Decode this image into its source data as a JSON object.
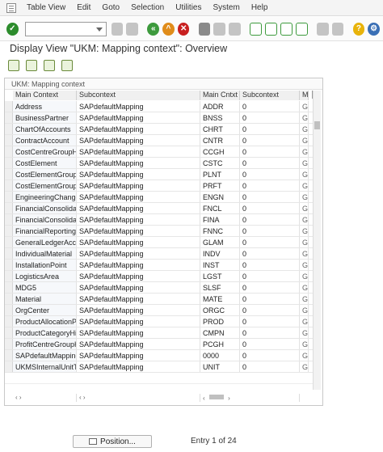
{
  "menubar": {
    "items": [
      "Table View",
      "Edit",
      "Goto",
      "Selection",
      "Utilities",
      "System",
      "Help"
    ]
  },
  "page_title": "Display View \"UKM: Mapping context\": Overview",
  "table": {
    "caption": "UKM: Mapping context",
    "headers": [
      "Main Context",
      "Subcontext",
      "Main Cntxt",
      "Subcontext",
      "Ma"
    ],
    "rows": [
      [
        "Address",
        "SAPdefaultMapping",
        "ADDR",
        "0",
        "G"
      ],
      [
        "BusinessPartner",
        "SAPdefaultMapping",
        "BNSS",
        "0",
        "G"
      ],
      [
        "ChartOfAccounts",
        "SAPdefaultMapping",
        "CHRT",
        "0",
        "G"
      ],
      [
        "ContractAccount",
        "SAPdefaultMapping",
        "CNTR",
        "0",
        "G"
      ],
      [
        "CostCentreGroupHi...",
        "SAPdefaultMapping",
        "CCGH",
        "0",
        "G"
      ],
      [
        "CostElement",
        "SAPdefaultMapping",
        "CSTC",
        "0",
        "G"
      ],
      [
        "CostElementGroup",
        "SAPdefaultMapping",
        "PLNT",
        "0",
        "G"
      ],
      [
        "CostElementGroupH...",
        "SAPdefaultMapping",
        "PRFT",
        "0",
        "G"
      ],
      [
        "EngineeringChange...",
        "SAPdefaultMapping",
        "ENGN",
        "0",
        "G"
      ],
      [
        "FinancialConsolidatio...",
        "SAPdefaultMapping",
        "FNCL",
        "0",
        "G"
      ],
      [
        "FinancialConsolidatio...",
        "SAPdefaultMapping",
        "FINA",
        "0",
        "G"
      ],
      [
        "FinancialReportingSt...",
        "SAPdefaultMapping",
        "FNNC",
        "0",
        "G"
      ],
      [
        "GeneralLedgerAcco...",
        "SAPdefaultMapping",
        "GLAM",
        "0",
        "G"
      ],
      [
        "IndividualMaterial",
        "SAPdefaultMapping",
        "INDV",
        "0",
        "G"
      ],
      [
        "InstallationPoint",
        "SAPdefaultMapping",
        "INST",
        "0",
        "G"
      ],
      [
        "LogisticsArea",
        "SAPdefaultMapping",
        "LGST",
        "0",
        "G"
      ],
      [
        "MDG5",
        "SAPdefaultMapping",
        "SLSF",
        "0",
        "G"
      ],
      [
        "Material",
        "SAPdefaultMapping",
        "MATE",
        "0",
        "G"
      ],
      [
        "OrgCenter",
        "SAPdefaultMapping",
        "ORGC",
        "0",
        "G"
      ],
      [
        "ProductAllocationPr...",
        "SAPdefaultMapping",
        "PROD",
        "0",
        "G"
      ],
      [
        "ProductCategoryHie...",
        "SAPdefaultMapping",
        "CMPN",
        "0",
        "G"
      ],
      [
        "ProfitCentreGroupHi...",
        "SAPdefaultMapping",
        "PCGH",
        "0",
        "G"
      ],
      [
        "SAPdefaultMapping",
        "SAPdefaultMapping",
        "0000",
        "0",
        "G"
      ],
      [
        "UKMSInternalUnitTe...",
        "SAPdefaultMapping",
        "UNIT",
        "0",
        "G"
      ]
    ]
  },
  "footer": {
    "position_button": "Position...",
    "entry_text": "Entry 1 of 24"
  }
}
